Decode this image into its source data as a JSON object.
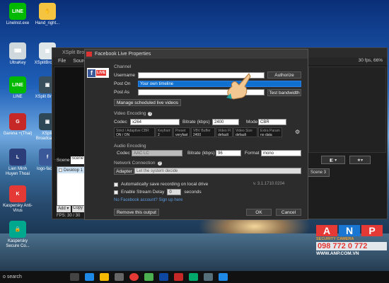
{
  "desktop_icons": [
    {
      "label": "LineInst.exe",
      "color": "#00b900",
      "glyph": "LINE"
    },
    {
      "label": "Hand_right...",
      "color": "#f5c542",
      "glyph": "✋"
    },
    {
      "label": "UltraKey",
      "color": "#cfd8dc",
      "glyph": "⌨"
    },
    {
      "label": "XSplitBroad...",
      "color": "#dfe6ea",
      "glyph": "▦"
    },
    {
      "label": "LINE",
      "color": "#00b900",
      "glyph": "LINE"
    },
    {
      "label": "XSplit Broa...",
      "color": "#3a4f5c",
      "glyph": "▣"
    },
    {
      "label": "Garena +(Thai)",
      "color": "#c62828",
      "glyph": "G"
    },
    {
      "label": "XSplit Broadcaster",
      "color": "#2f4858",
      "glyph": "▣"
    },
    {
      "label": "Lien Minh Huyen Thoai",
      "color": "#2c3e7a",
      "glyph": "L"
    },
    {
      "label": "logo-face...",
      "color": "#3b5998",
      "glyph": "f"
    },
    {
      "label": "Kaspersky Anti-Virus",
      "color": "#e53935",
      "glyph": "K"
    },
    {
      "label": "Kaspersky Secure Co...",
      "color": "#00a88e",
      "glyph": "🔒"
    }
  ],
  "xsplit": {
    "title": "XSplit Broa",
    "menu": [
      "File",
      "Sourc"
    ],
    "fps_right": "30 fps, 66%",
    "scene_label": "Scene",
    "scene_tab": "Scene",
    "scene3": "Scene 3",
    "desktop_item": "Desktop 1",
    "add": "Add ▾",
    "copy": "Copy",
    "fps": "FPS:  30 / 30"
  },
  "dialog": {
    "title": "Facebook Live Properties",
    "live_badge": "LIVE",
    "channel_heading": "Channel",
    "username_label": "Username",
    "username_value": "",
    "authorize": "Authorize",
    "post_on_label": "Post On",
    "post_on_value": "Your own timeline",
    "post_as_label": "Post As",
    "test_bandwidth": "Test bandwidth",
    "manage_btn": "Manage scheduled live videos",
    "video_heading": "Video Encoding",
    "codec_label": "Codec",
    "codec_value": "x264",
    "bitrate_label": "Bitrate (kbps)",
    "bitrate_value": "2400",
    "mode_label": "Mode",
    "mode_value": "CBR",
    "enc_cells": [
      {
        "k": "Strict / Adaptive CBR",
        "v": "ON / ON"
      },
      {
        "k": "Keyframes",
        "v": "2"
      },
      {
        "k": "Preset",
        "v": "veryfast"
      },
      {
        "k": "VBV Buffer",
        "v": "2400"
      },
      {
        "k": "Video FPS",
        "v": "default"
      },
      {
        "k": "Video Size",
        "v": "default"
      },
      {
        "k": "Extra Param",
        "v": "no data"
      }
    ],
    "audio_heading": "Audio Encoding",
    "a_codec_label": "Codec",
    "a_codec_value": "AAC LC",
    "a_bitrate_label": "Bitrate (kbps)",
    "a_bitrate_value": "96",
    "format_label": "Format",
    "format_value": "mono",
    "network_heading": "Network Connection",
    "adapter_label": "Adapter",
    "adapter_value": "Let the system decide",
    "auto_save": "Automatically save recording on local drive",
    "stream_delay": "Enable Stream Delay",
    "delay_value": "0",
    "seconds": "seconds",
    "version": "v. 3.1.1710.0204",
    "signup_link": "No Facebook account? Sign up here",
    "remove_btn": "Remove this output",
    "ok": "OK",
    "cancel": "Cancel"
  },
  "taskbar": {
    "search": "o search"
  },
  "watermark": {
    "logo": "ANP",
    "sub": "SECURITY CAMERA",
    "phone": "098 772 0 772",
    "web": "WWW.ANP.COM.VN"
  }
}
